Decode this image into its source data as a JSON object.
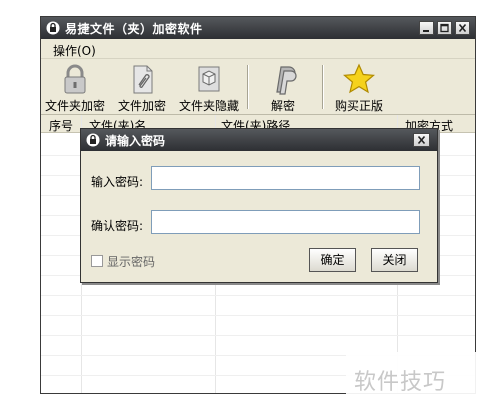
{
  "window": {
    "title": "易捷文件（夹）加密软件",
    "controls": [
      "minimize",
      "maximize",
      "close"
    ]
  },
  "menu": {
    "operate": "操作(O)"
  },
  "toolbar": {
    "items": [
      {
        "label": "文件夹加密",
        "icon": "padlock-icon"
      },
      {
        "label": "文件加密",
        "icon": "file-paperclip-icon"
      },
      {
        "label": "文件夹隐藏",
        "icon": "box-icon"
      },
      {
        "label": "解密",
        "icon": "paypal-p-icon"
      },
      {
        "label": "购买正版",
        "icon": "star-icon"
      }
    ]
  },
  "table": {
    "columns": [
      "序号",
      "文件(夹)名",
      "文件(夹)路径",
      "加密方式"
    ]
  },
  "dialog": {
    "title": "请输入密码",
    "password_label": "输入密码:",
    "confirm_label": "确认密码:",
    "password_value": "",
    "confirm_value": "",
    "show_password_label": "显示密码",
    "show_password_checked": false,
    "ok_label": "确定",
    "close_label": "关闭"
  },
  "watermark": {
    "text": "软件技巧"
  },
  "colors": {
    "titlebar": "#3a3d41",
    "dialog_bg": "#ece9d8",
    "input_border": "#7f9db9",
    "star": "#f5d21c"
  }
}
